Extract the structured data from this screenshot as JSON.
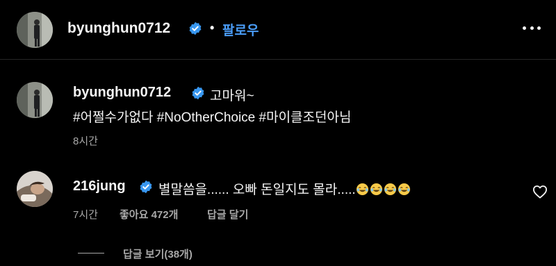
{
  "header": {
    "username": "byunghun0712",
    "separator": "•",
    "follow_label": "팔로우"
  },
  "caption": {
    "username": "byunghun0712",
    "text_line1": "고마워~",
    "text_line2": "#어쩔수가없다 #NoOtherChoice #마이클조던아님",
    "time": "8시간"
  },
  "comment": {
    "username": "216jung",
    "text": "별말씀을...... 오빠 돈일지도 몰라.....",
    "emoji": "😂😂😂😂",
    "time": "7시간",
    "likes": "좋아요 472개",
    "reply_label": "답글 달기",
    "view_replies": "답글 보기(38개)"
  },
  "colors": {
    "background": "#000000",
    "text": "#f5f5f5",
    "muted": "#a8a8a8",
    "follow": "#4a9df8",
    "verified": "#3897f0"
  },
  "icons": [
    "verified-badge-icon",
    "more-options-icon",
    "heart-outline-icon",
    "tears-of-joy-emoji-icon"
  ]
}
